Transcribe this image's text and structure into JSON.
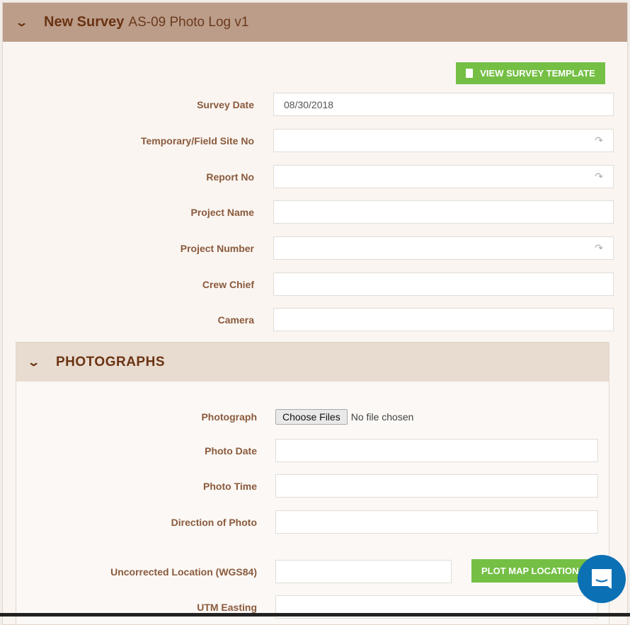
{
  "header": {
    "title": "New Survey",
    "subtitle": "AS-09 Photo Log v1"
  },
  "view_template_label": "VIEW SURVEY TEMPLATE",
  "fields": [
    {
      "label": "Survey Date",
      "value": "08/30/2018",
      "lookup": false
    },
    {
      "label": "Temporary/Field Site No",
      "value": "",
      "lookup": true
    },
    {
      "label": "Report No",
      "value": "",
      "lookup": true
    },
    {
      "label": "Project Name",
      "value": "",
      "lookup": false
    },
    {
      "label": "Project Number",
      "value": "",
      "lookup": true
    },
    {
      "label": "Crew Chief",
      "value": "",
      "lookup": false
    },
    {
      "label": "Camera",
      "value": "",
      "lookup": false
    }
  ],
  "photographs": {
    "title": "PHOTOGRAPHS",
    "photograph_label": "Photograph",
    "choose_files": "Choose Files",
    "no_file": "No file chosen",
    "photo_date_label": "Photo Date",
    "photo_time_label": "Photo Time",
    "direction_label": "Direction of Photo",
    "uncorrected_label": "Uncorrected Location (WGS84)",
    "plot_map_label": "PLOT MAP LOCATION",
    "utm_easting_label": "UTM Easting"
  },
  "colors": {
    "header": "#bb9d8a",
    "accent_green": "#74bf44",
    "chat": "#0b70b4"
  }
}
